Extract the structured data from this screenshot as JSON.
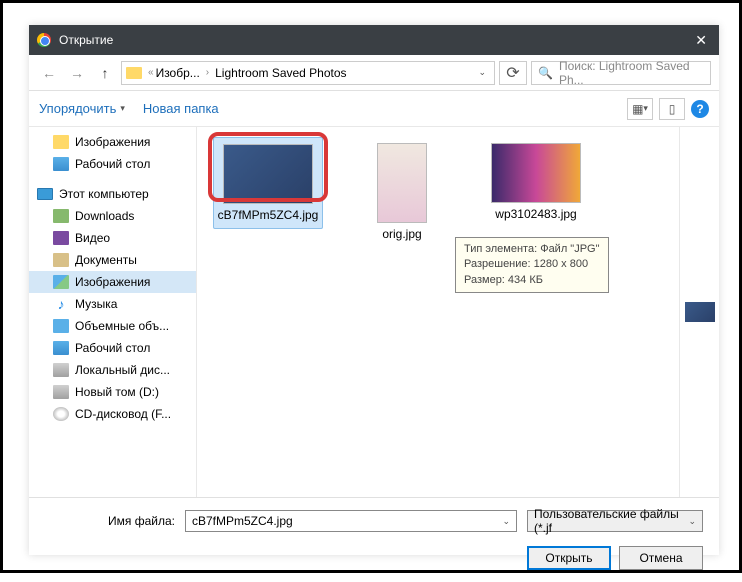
{
  "titlebar": {
    "title": "Открытие"
  },
  "nav": {
    "breadcrumb": {
      "seg1": "Изобр...",
      "seg2": "Lightroom Saved Photos"
    },
    "search_placeholder": "Поиск: Lightroom Saved Ph..."
  },
  "toolbar": {
    "organize": "Упорядочить",
    "new_folder": "Новая папка"
  },
  "sidebar": {
    "items": [
      {
        "label": "Изображения"
      },
      {
        "label": "Рабочий стол"
      },
      {
        "label": "Этот компьютер"
      },
      {
        "label": "Downloads"
      },
      {
        "label": "Видео"
      },
      {
        "label": "Документы"
      },
      {
        "label": "Изображения"
      },
      {
        "label": "Музыка"
      },
      {
        "label": "Объемные объ..."
      },
      {
        "label": "Рабочий стол"
      },
      {
        "label": "Локальный дис..."
      },
      {
        "label": "Новый том (D:)"
      },
      {
        "label": "CD-дисковод (F..."
      }
    ]
  },
  "files": [
    {
      "name": "cB7fMPm5ZC4.jpg"
    },
    {
      "name": "orig.jpg"
    },
    {
      "name": "wp3102483.jpg"
    }
  ],
  "tooltip": {
    "line1": "Тип элемента: Файл \"JPG\"",
    "line2": "Разрешение: 1280 x 800",
    "line3": "Размер: 434 КБ"
  },
  "bottom": {
    "filename_label": "Имя файла:",
    "filename_value": "cB7fMPm5ZC4.jpg",
    "filter": "Пользовательские файлы (*.jf",
    "open": "Открыть",
    "cancel": "Отмена"
  }
}
